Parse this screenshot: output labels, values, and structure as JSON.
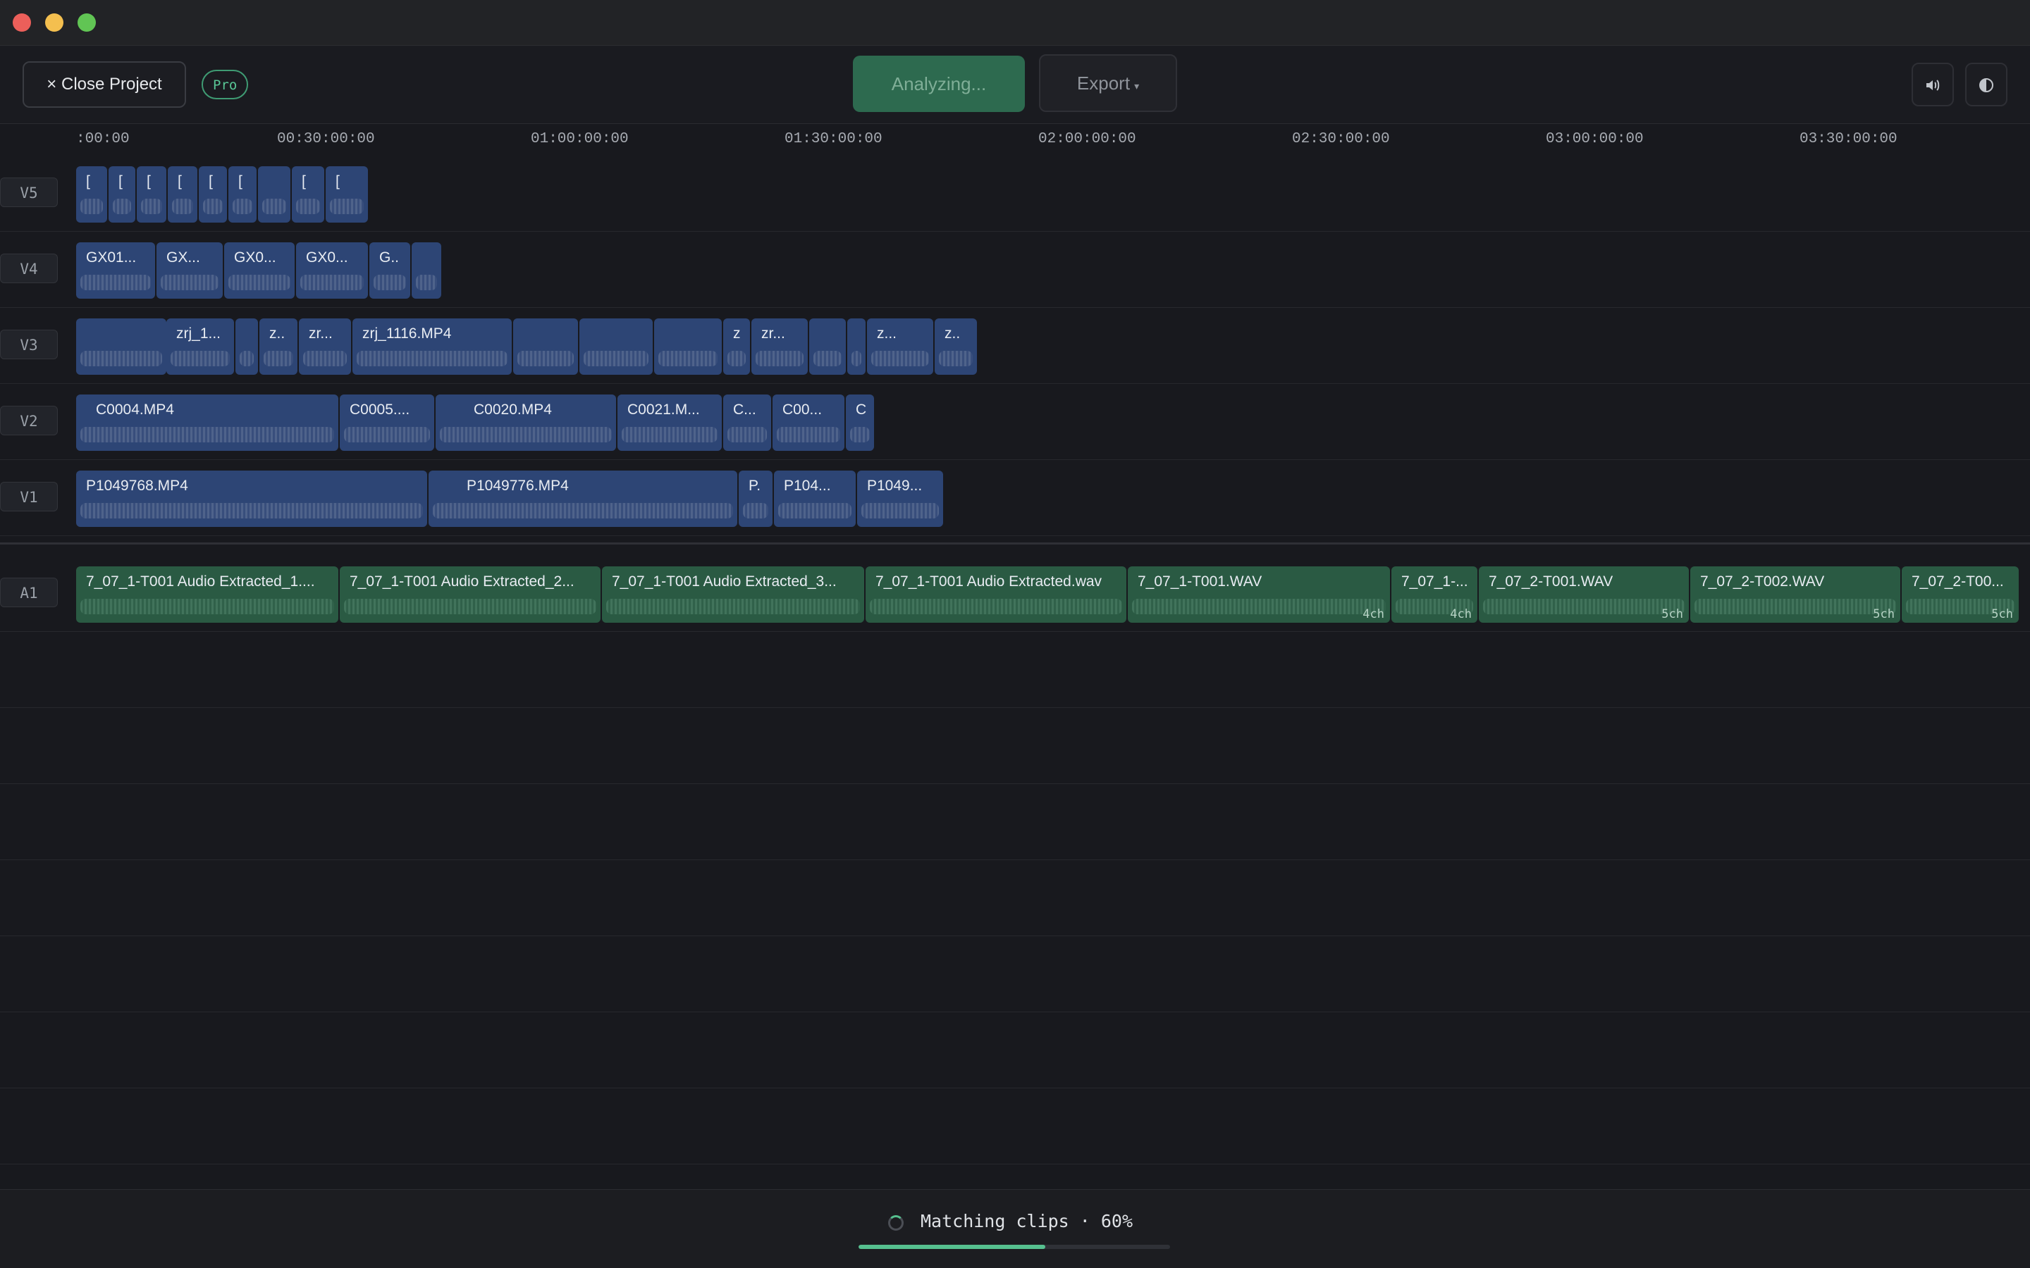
{
  "toolbar": {
    "close_project": "× Close Project",
    "pro_badge": "Pro",
    "analyze": "Analyzing...",
    "export": "Export",
    "export_caret": "▾",
    "volume_icon": "speaker-icon",
    "theme_icon": "contrast-icon"
  },
  "ruler": {
    "ticks": [
      ":00:00",
      "00:30:00:00",
      "01:00:00:00",
      "01:30:00:00",
      "02:00:00:00",
      "02:30:00:00",
      "03:00:00:00",
      "03:30:00:00"
    ]
  },
  "tracks": {
    "V5": {
      "label": "V5",
      "clips": [
        "[",
        "[",
        "[",
        "[",
        "[",
        "[",
        "",
        "[",
        "["
      ]
    },
    "V4": {
      "label": "V4",
      "clips": [
        "GX01...",
        "GX...",
        "GX0...",
        "GX0...",
        "G..",
        ""
      ]
    },
    "V3": {
      "label": "V3",
      "clips": [
        "",
        "zrj_1...",
        "",
        "z..",
        "zr...",
        "zrj_1116.MP4",
        "",
        "",
        "",
        "z",
        "zr...",
        "",
        "",
        "z...",
        "z.."
      ]
    },
    "V2": {
      "label": "V2",
      "clips": [
        "C0004.MP4",
        "C0005....",
        "C0020.MP4",
        "C0021.M...",
        "C...",
        "C00...",
        "C"
      ]
    },
    "V1": {
      "label": "V1",
      "clips": [
        "P1049768.MP4",
        "P1049776.MP4",
        "P.",
        "P104...",
        "P1049..."
      ]
    },
    "A1": {
      "label": "A1",
      "clips": [
        "7_07_1-T001 Audio Extracted_1....",
        "7_07_1-T001 Audio Extracted_2...",
        "7_07_1-T001 Audio Extracted_3...",
        "7_07_1-T001 Audio Extracted.wav",
        "7_07_1-T001.WAV",
        "7_07_1-...",
        "7_07_2-T001.WAV",
        "7_07_2-T002.WAV",
        "7_07_2-T00..."
      ],
      "channels": [
        "",
        "",
        "",
        "",
        "4ch",
        "4ch",
        "5ch",
        "5ch",
        "5ch"
      ]
    }
  },
  "status": {
    "text": "Matching clips · 60%",
    "progress": 0.6
  },
  "colors": {
    "video_clip": "#2d4575",
    "audio_clip": "#2a5a43",
    "accent": "#56c08f"
  }
}
